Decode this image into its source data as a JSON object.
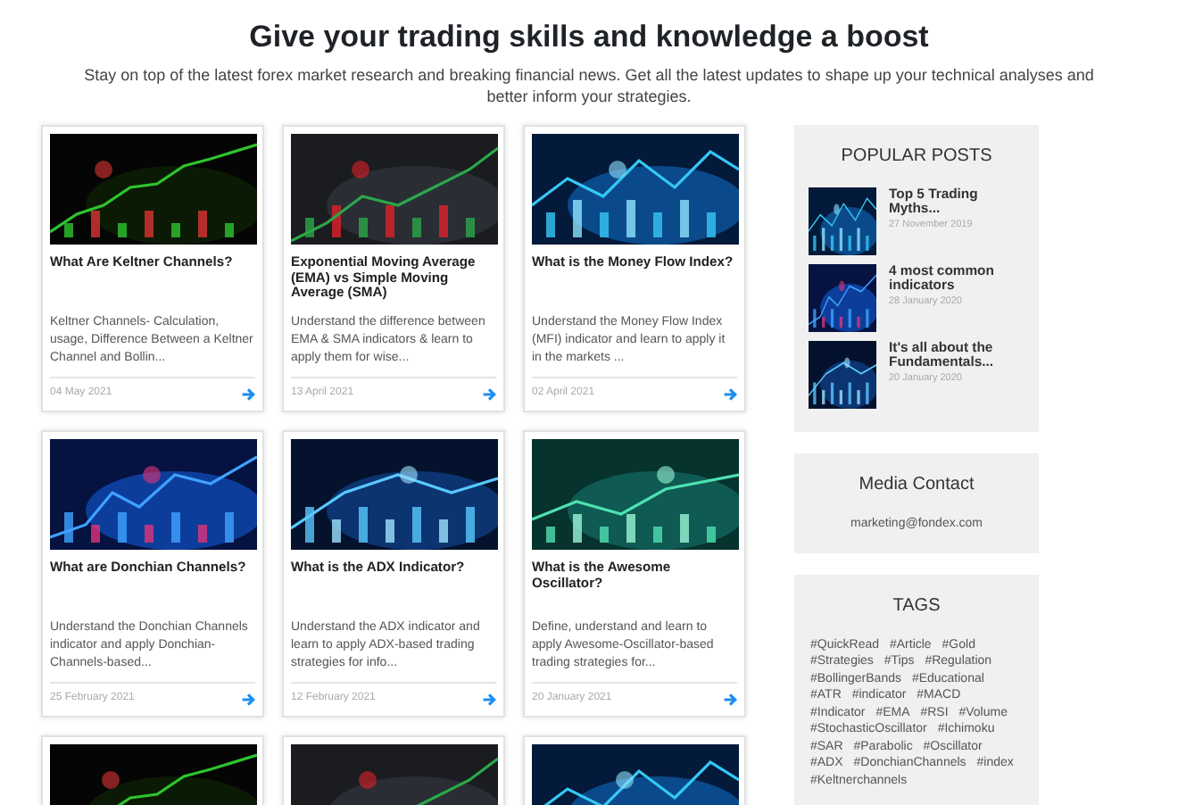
{
  "heading": "Give your trading skills and knowledge a boost",
  "intro": "Stay on top of the latest forex market research and breaking financial news. Get all the latest updates to shape up your technical analyses and better inform your strategies.",
  "posts": [
    {
      "image": {
        "kind": "picture"
      },
      "title": "What Are Keltner Channels?",
      "excerpt": "Keltner Channels- Calculation, usage, Difference Between a Keltner Channel and Bollin...",
      "date": "04 May 2021"
    },
    {
      "image": {
        "kind": "picture"
      },
      "title": "Exponential Moving Average (EMA) vs Simple Moving Average (SMA)",
      "excerpt": "Understand the difference between EMA & SMA indicators & learn to apply them for wise...",
      "date": "13 April 2021"
    },
    {
      "image": {
        "kind": "picture"
      },
      "title": "What is the Money Flow Index?",
      "excerpt": "Understand the Money Flow Index (MFI) indicator and learn to apply it in the markets ...",
      "date": "02 April 2021"
    },
    {
      "image": {
        "kind": "picture"
      },
      "title": "What are Donchian Channels?",
      "excerpt": "Understand the Donchian Channels indicator and apply Donchian-Channels-based...",
      "date": "25 February 2021"
    },
    {
      "image": {
        "kind": "picture"
      },
      "title": "What is the ADX Indicator?",
      "excerpt": "Understand the ADX indicator and learn to apply ADX-based trading strategies for info...",
      "date": "12 February 2021"
    },
    {
      "image": {
        "kind": "picture"
      },
      "title": "What is the Awesome Oscillator?",
      "excerpt": "Define, understand and learn to apply Awesome-Oscillator-based trading strategies for...",
      "date": "20 January 2021"
    },
    {
      "image": {
        "kind": "picture"
      }
    },
    {
      "image": {
        "kind": "picture"
      }
    },
    {
      "image": {
        "kind": "picture"
      }
    }
  ],
  "popular": {
    "title": "POPULAR POSTS",
    "items": [
      {
        "image": {
          "kind": "picture"
        },
        "title": "Top 5 Trading Myths...",
        "date": "27 November 2019"
      },
      {
        "image": {
          "kind": "picture"
        },
        "title": "4 most common indicators",
        "date": "28 January 2020"
      },
      {
        "image": {
          "kind": "picture"
        },
        "title": "It's all about the Fundamentals...",
        "date": "20 January 2020"
      }
    ]
  },
  "media_contact": {
    "title": "Media Contact",
    "email": "marketing@fondex.com"
  },
  "tags": {
    "title": "TAGS",
    "items": [
      "#QuickRead",
      "#Article",
      "#Gold",
      "#Strategies",
      "#Tips",
      "#Regulation",
      "#BollingerBands",
      "#Educational",
      "#ATR",
      "#indicator",
      "#MACD",
      "#Indicator",
      "#EMA",
      "#RSI",
      "#Volume",
      "#StochasticOscillator",
      "#Ichimoku",
      "#SAR",
      "#Parabolic",
      "#Oscillator",
      "#ADX",
      "#DonchianChannels",
      "#index",
      "#Keltnerchannels"
    ]
  }
}
